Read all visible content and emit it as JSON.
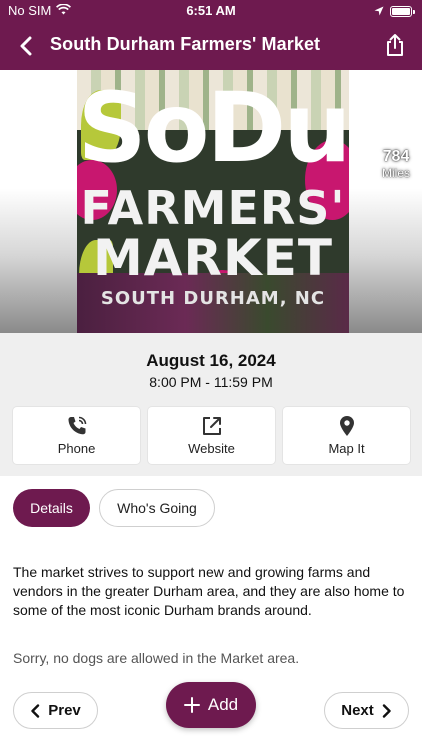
{
  "status_bar": {
    "carrier": "No SIM",
    "time": "6:51 AM"
  },
  "header": {
    "title": "South Durham Farmers' Market",
    "back_icon": "chevron-left-icon",
    "share_icon": "share-icon"
  },
  "hero": {
    "poster_lines": [
      "SoDu",
      "FARMERS'",
      "MARKET",
      "SOUTH DURHAM, NC"
    ],
    "distance_value": "784",
    "distance_unit": "Miles"
  },
  "event": {
    "date": "August 16, 2024",
    "time_range": "8:00 PM - 11:59 PM"
  },
  "actions": [
    {
      "label": "Phone",
      "icon": "phone-icon"
    },
    {
      "label": "Website",
      "icon": "external-link-icon"
    },
    {
      "label": "Map It",
      "icon": "map-pin-icon"
    }
  ],
  "tabs": [
    {
      "label": "Details",
      "active": true
    },
    {
      "label": "Who's Going",
      "active": false
    }
  ],
  "details": {
    "description": "The market strives to support new and growing farms and vendors in the greater Durham area, and they are also home to some of the most iconic Durham brands around.",
    "note": "Sorry, no dogs are allowed in the Market area."
  },
  "footer": {
    "prev_label": "Prev",
    "add_label": "Add",
    "next_label": "Next"
  },
  "colors": {
    "brand": "#6e1a4f",
    "background": "#efefef"
  }
}
